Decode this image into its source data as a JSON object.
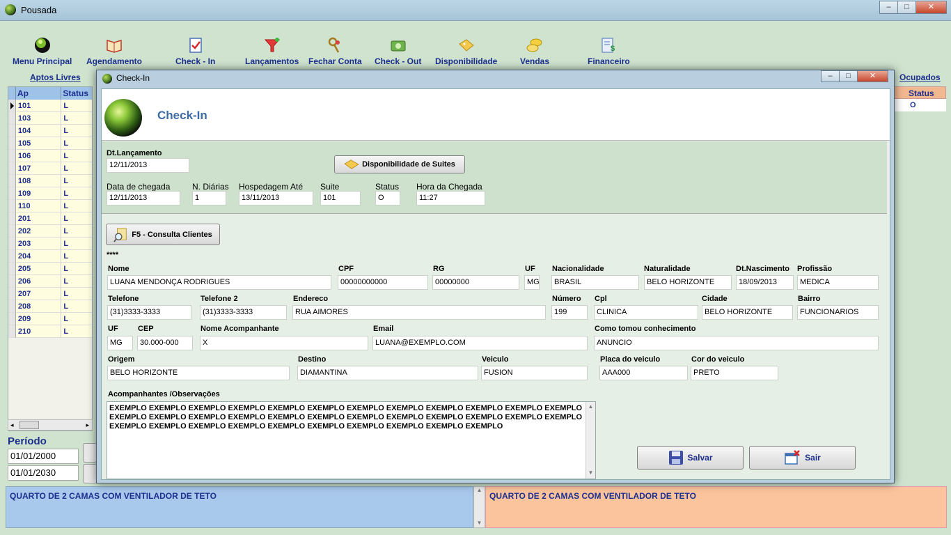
{
  "window": {
    "title": "Pousada",
    "min": "‒",
    "max": "□",
    "close": "✕"
  },
  "toolbar": [
    {
      "label": "Menu Principal",
      "icon": "globe-icon"
    },
    {
      "label": "Agendamento",
      "icon": "book-icon"
    },
    {
      "label": "Check  - In",
      "icon": "checklist-icon"
    },
    {
      "label": "Lançamentos",
      "icon": "funnel-icon"
    },
    {
      "label": "Fechar Conta",
      "icon": "keys-icon"
    },
    {
      "label": "Check - Out",
      "icon": "money-icon"
    },
    {
      "label": "Disponibilidade",
      "icon": "tag-icon"
    },
    {
      "label": "Vendas",
      "icon": "coins-icon"
    },
    {
      "label": "Financeiro",
      "icon": "ledger-icon"
    }
  ],
  "links": {
    "aptos_livres": "Aptos Livres",
    "ocupados": "Ocupados"
  },
  "left_grid": {
    "headers": {
      "ap": "Ap",
      "status": "Status"
    },
    "rows": [
      {
        "ap": "101",
        "status": "L"
      },
      {
        "ap": "103",
        "status": "L"
      },
      {
        "ap": "104",
        "status": "L"
      },
      {
        "ap": "105",
        "status": "L"
      },
      {
        "ap": "106",
        "status": "L"
      },
      {
        "ap": "107",
        "status": "L"
      },
      {
        "ap": "108",
        "status": "L"
      },
      {
        "ap": "109",
        "status": "L"
      },
      {
        "ap": "110",
        "status": "L"
      },
      {
        "ap": "201",
        "status": "L"
      },
      {
        "ap": "202",
        "status": "L"
      },
      {
        "ap": "203",
        "status": "L"
      },
      {
        "ap": "204",
        "status": "L"
      },
      {
        "ap": "205",
        "status": "L"
      },
      {
        "ap": "206",
        "status": "L"
      },
      {
        "ap": "207",
        "status": "L"
      },
      {
        "ap": "208",
        "status": "L"
      },
      {
        "ap": "209",
        "status": "L"
      },
      {
        "ap": "210",
        "status": "L"
      }
    ]
  },
  "right_grid": {
    "status_header": "Status",
    "first_value": "O"
  },
  "periodo": {
    "label": "Período",
    "start": "01/01/2000",
    "end": "01/01/2030"
  },
  "bottom": {
    "left_text": "QUARTO DE 2 CAMAS COM VENTILADOR DE TETO",
    "right_text": "QUARTO DE 2 CAMAS COM VENTILADOR DE TETO"
  },
  "dialog": {
    "title": "Check-In",
    "header_title": "Check-In",
    "dt_lancamento_label": "Dt.Lançamento",
    "dt_lancamento": "12/11/2013",
    "disponibilidade_btn": "Disponibilidade de Suites",
    "data_chegada_label": "Data de chegada",
    "data_chegada": "12/11/2013",
    "n_diarias_label": "N. Diárias",
    "n_diarias": "1",
    "hospedagem_ate_label": "Hospedagem Até",
    "hospedagem_ate": "13/11/2013",
    "suite_label": "Suite",
    "suite": "101",
    "status_label": "Status",
    "status": "O",
    "hora_chegada_label": "Hora da Chegada",
    "hora_chegada": "11:27",
    "consulta_btn": "F5 - Consulta Clientes",
    "stars": "****",
    "fields": {
      "nome": {
        "label": "Nome",
        "value": "LUANA MENDONÇA RODRIGUES"
      },
      "cpf": {
        "label": "CPF",
        "value": "00000000000"
      },
      "rg": {
        "label": "RG",
        "value": "00000000"
      },
      "uf1": {
        "label": "UF",
        "value": "MG"
      },
      "nacionalidade": {
        "label": "Nacionalidade",
        "value": "BRASIL"
      },
      "naturalidade": {
        "label": "Naturalidade",
        "value": "BELO HORIZONTE"
      },
      "dt_nascimento": {
        "label": "Dt.Nascimento",
        "value": "18/09/2013"
      },
      "profissao": {
        "label": "Profissão",
        "value": "MEDICA"
      },
      "telefone": {
        "label": "Telefone",
        "value": "(31)3333-3333"
      },
      "telefone2": {
        "label": "Telefone 2",
        "value": "(31)3333-3333"
      },
      "endereco": {
        "label": "Endereco",
        "value": "RUA AIMORES"
      },
      "numero": {
        "label": "Número",
        "value": "199"
      },
      "cpl": {
        "label": "Cpl",
        "value": "CLINICA"
      },
      "cidade": {
        "label": "Cidade",
        "value": "BELO HORIZONTE"
      },
      "bairro": {
        "label": "Bairro",
        "value": "FUNCIONARIOS"
      },
      "uf2": {
        "label": "UF",
        "value": "MG"
      },
      "cep": {
        "label": "CEP",
        "value": "30.000-000"
      },
      "acompanhante": {
        "label": "Nome Acompanhante",
        "value": "X"
      },
      "email": {
        "label": "Email",
        "value": "LUANA@EXEMPLO.COM"
      },
      "conhecimento": {
        "label": "Como tomou conhecimento",
        "value": "ANUNCIO"
      },
      "origem": {
        "label": "Origem",
        "value": "BELO HORIZONTE"
      },
      "destino": {
        "label": "Destino",
        "value": "DIAMANTINA"
      },
      "veiculo": {
        "label": "Veiculo",
        "value": "FUSION"
      },
      "placa": {
        "label": "Placa do veiculo",
        "value": "AAA000"
      },
      "cor": {
        "label": "Cor do veiculo",
        "value": "PRETO"
      }
    },
    "obs_label": "Acompanhantes /Observações",
    "obs_lines": [
      "EXEMPLO EXEMPLO EXEMPLO EXEMPLO EXEMPLO EXEMPLO EXEMPLO EXEMPLO EXEMPLO EXEMPLO EXEMPLO EXEMPLO",
      "EXEMPLO EXEMPLO EXEMPLO EXEMPLO EXEMPLO EXEMPLO EXEMPLO EXEMPLO EXEMPLO EXEMPLO EXEMPLO EXEMPLO",
      "EXEMPLO EXEMPLO EXEMPLO EXEMPLO EXEMPLO EXEMPLO EXEMPLO EXEMPLO EXEMPLO EXEMPLO"
    ],
    "salvar_btn": "Salvar",
    "sair_btn": "Sair"
  }
}
